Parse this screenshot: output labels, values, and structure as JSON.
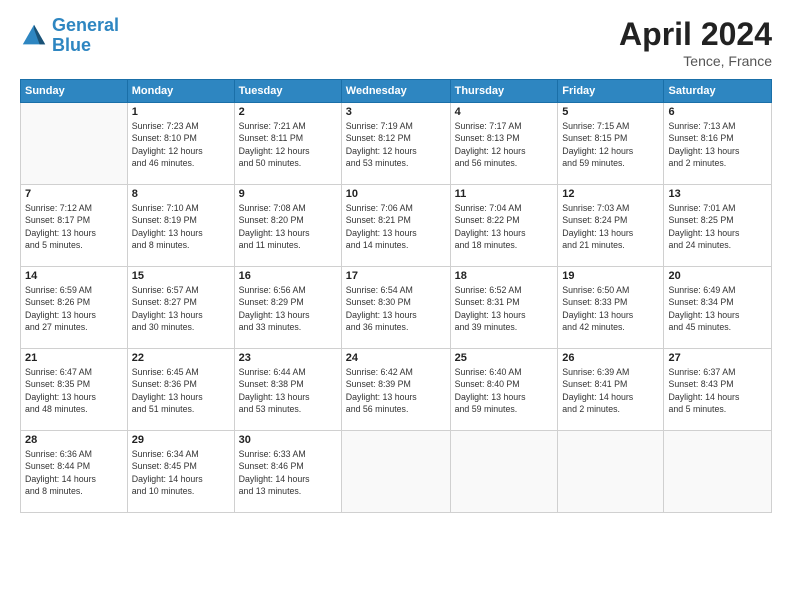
{
  "header": {
    "logo_line1": "General",
    "logo_line2": "Blue",
    "month": "April 2024",
    "location": "Tence, France"
  },
  "days_of_week": [
    "Sunday",
    "Monday",
    "Tuesday",
    "Wednesday",
    "Thursday",
    "Friday",
    "Saturday"
  ],
  "weeks": [
    [
      {
        "day": "",
        "info": ""
      },
      {
        "day": "1",
        "info": "Sunrise: 7:23 AM\nSunset: 8:10 PM\nDaylight: 12 hours\nand 46 minutes."
      },
      {
        "day": "2",
        "info": "Sunrise: 7:21 AM\nSunset: 8:11 PM\nDaylight: 12 hours\nand 50 minutes."
      },
      {
        "day": "3",
        "info": "Sunrise: 7:19 AM\nSunset: 8:12 PM\nDaylight: 12 hours\nand 53 minutes."
      },
      {
        "day": "4",
        "info": "Sunrise: 7:17 AM\nSunset: 8:13 PM\nDaylight: 12 hours\nand 56 minutes."
      },
      {
        "day": "5",
        "info": "Sunrise: 7:15 AM\nSunset: 8:15 PM\nDaylight: 12 hours\nand 59 minutes."
      },
      {
        "day": "6",
        "info": "Sunrise: 7:13 AM\nSunset: 8:16 PM\nDaylight: 13 hours\nand 2 minutes."
      }
    ],
    [
      {
        "day": "7",
        "info": "Sunrise: 7:12 AM\nSunset: 8:17 PM\nDaylight: 13 hours\nand 5 minutes."
      },
      {
        "day": "8",
        "info": "Sunrise: 7:10 AM\nSunset: 8:19 PM\nDaylight: 13 hours\nand 8 minutes."
      },
      {
        "day": "9",
        "info": "Sunrise: 7:08 AM\nSunset: 8:20 PM\nDaylight: 13 hours\nand 11 minutes."
      },
      {
        "day": "10",
        "info": "Sunrise: 7:06 AM\nSunset: 8:21 PM\nDaylight: 13 hours\nand 14 minutes."
      },
      {
        "day": "11",
        "info": "Sunrise: 7:04 AM\nSunset: 8:22 PM\nDaylight: 13 hours\nand 18 minutes."
      },
      {
        "day": "12",
        "info": "Sunrise: 7:03 AM\nSunset: 8:24 PM\nDaylight: 13 hours\nand 21 minutes."
      },
      {
        "day": "13",
        "info": "Sunrise: 7:01 AM\nSunset: 8:25 PM\nDaylight: 13 hours\nand 24 minutes."
      }
    ],
    [
      {
        "day": "14",
        "info": "Sunrise: 6:59 AM\nSunset: 8:26 PM\nDaylight: 13 hours\nand 27 minutes."
      },
      {
        "day": "15",
        "info": "Sunrise: 6:57 AM\nSunset: 8:27 PM\nDaylight: 13 hours\nand 30 minutes."
      },
      {
        "day": "16",
        "info": "Sunrise: 6:56 AM\nSunset: 8:29 PM\nDaylight: 13 hours\nand 33 minutes."
      },
      {
        "day": "17",
        "info": "Sunrise: 6:54 AM\nSunset: 8:30 PM\nDaylight: 13 hours\nand 36 minutes."
      },
      {
        "day": "18",
        "info": "Sunrise: 6:52 AM\nSunset: 8:31 PM\nDaylight: 13 hours\nand 39 minutes."
      },
      {
        "day": "19",
        "info": "Sunrise: 6:50 AM\nSunset: 8:33 PM\nDaylight: 13 hours\nand 42 minutes."
      },
      {
        "day": "20",
        "info": "Sunrise: 6:49 AM\nSunset: 8:34 PM\nDaylight: 13 hours\nand 45 minutes."
      }
    ],
    [
      {
        "day": "21",
        "info": "Sunrise: 6:47 AM\nSunset: 8:35 PM\nDaylight: 13 hours\nand 48 minutes."
      },
      {
        "day": "22",
        "info": "Sunrise: 6:45 AM\nSunset: 8:36 PM\nDaylight: 13 hours\nand 51 minutes."
      },
      {
        "day": "23",
        "info": "Sunrise: 6:44 AM\nSunset: 8:38 PM\nDaylight: 13 hours\nand 53 minutes."
      },
      {
        "day": "24",
        "info": "Sunrise: 6:42 AM\nSunset: 8:39 PM\nDaylight: 13 hours\nand 56 minutes."
      },
      {
        "day": "25",
        "info": "Sunrise: 6:40 AM\nSunset: 8:40 PM\nDaylight: 13 hours\nand 59 minutes."
      },
      {
        "day": "26",
        "info": "Sunrise: 6:39 AM\nSunset: 8:41 PM\nDaylight: 14 hours\nand 2 minutes."
      },
      {
        "day": "27",
        "info": "Sunrise: 6:37 AM\nSunset: 8:43 PM\nDaylight: 14 hours\nand 5 minutes."
      }
    ],
    [
      {
        "day": "28",
        "info": "Sunrise: 6:36 AM\nSunset: 8:44 PM\nDaylight: 14 hours\nand 8 minutes."
      },
      {
        "day": "29",
        "info": "Sunrise: 6:34 AM\nSunset: 8:45 PM\nDaylight: 14 hours\nand 10 minutes."
      },
      {
        "day": "30",
        "info": "Sunrise: 6:33 AM\nSunset: 8:46 PM\nDaylight: 14 hours\nand 13 minutes."
      },
      {
        "day": "",
        "info": ""
      },
      {
        "day": "",
        "info": ""
      },
      {
        "day": "",
        "info": ""
      },
      {
        "day": "",
        "info": ""
      }
    ]
  ]
}
